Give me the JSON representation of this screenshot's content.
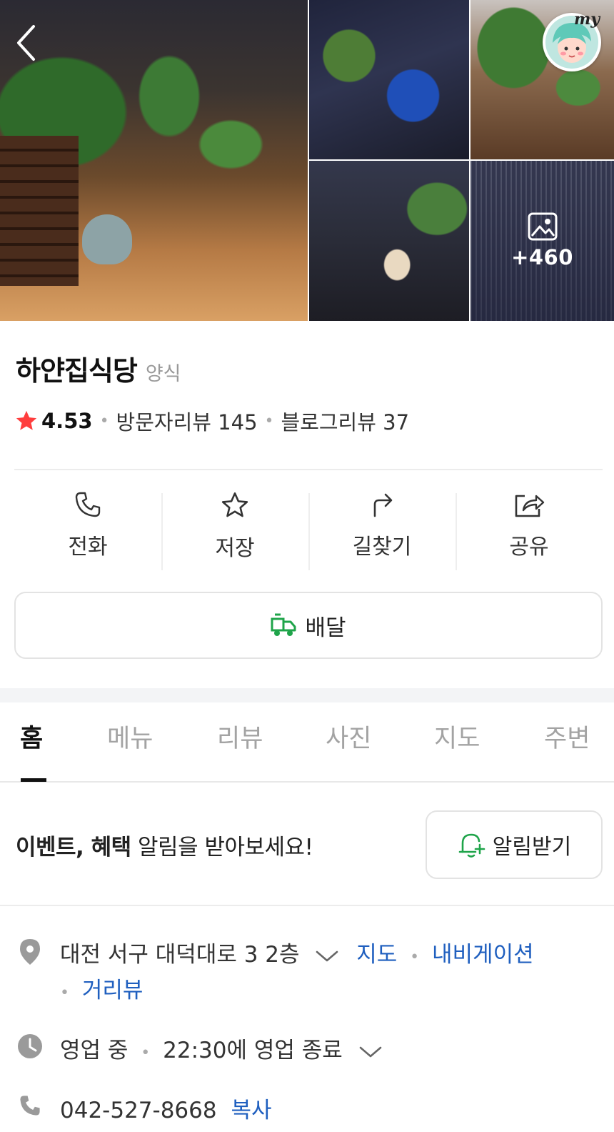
{
  "photos": {
    "more_count": "+460"
  },
  "header": {
    "my_label": "my"
  },
  "place": {
    "name": "하얀집식당",
    "category": "양식",
    "rating": "4.53",
    "visitor_reviews": "방문자리뷰 145",
    "blog_reviews": "블로그리뷰 37"
  },
  "actions": {
    "call": "전화",
    "save": "저장",
    "directions": "길찾기",
    "share": "공유",
    "delivery": "배달"
  },
  "tabs": [
    "홈",
    "메뉴",
    "리뷰",
    "사진",
    "지도",
    "주변"
  ],
  "notice": {
    "bold": "이벤트, 혜택",
    "rest": " 알림을 받아보세요!",
    "button": "알림받기"
  },
  "info": {
    "address": "대전 서구 대덕대로 3 2층",
    "map_link": "지도",
    "navigation_link": "내비게이션",
    "street_view_link": "거리뷰",
    "status": "영업 중",
    "closing": "22:30에 영업 종료",
    "phone": "042-527-8668",
    "copy_link": "복사"
  },
  "colors": {
    "accent_link": "#1f5fbf",
    "star": "#ff3d3d",
    "delivery_green": "#1fa44a"
  }
}
